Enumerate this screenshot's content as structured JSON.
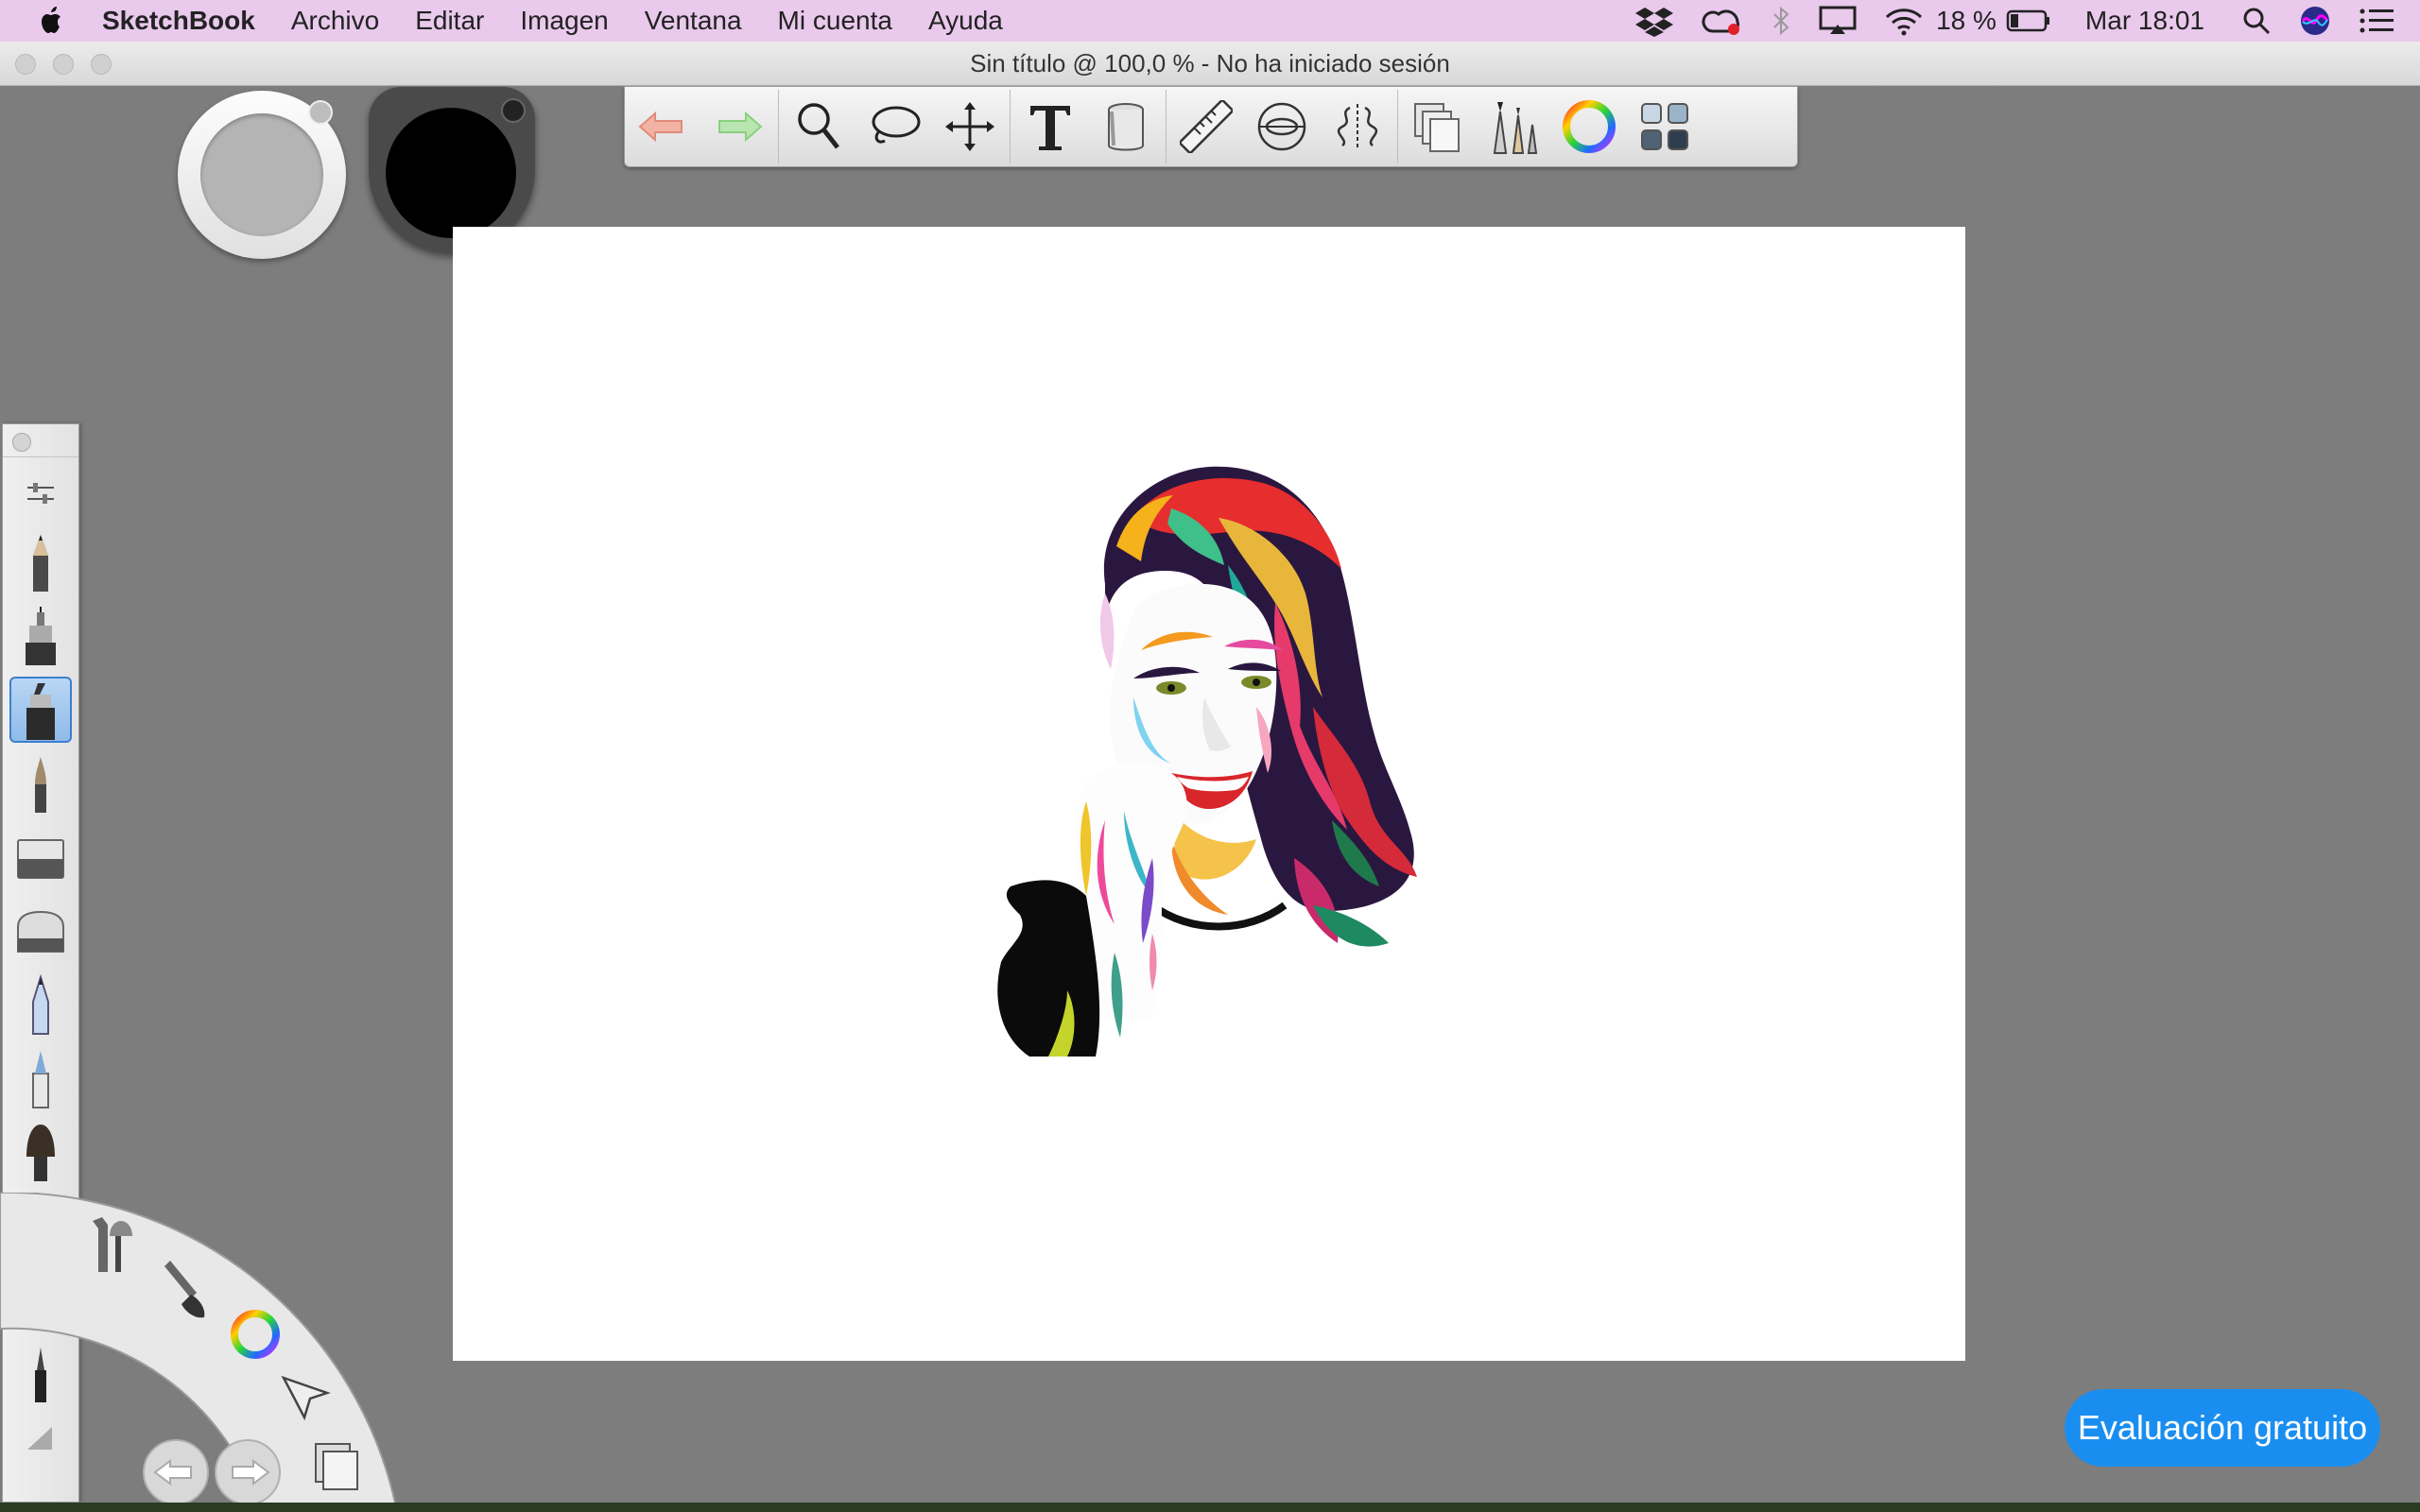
{
  "menubar": {
    "app_name": "SketchBook",
    "menus": [
      "Archivo",
      "Editar",
      "Imagen",
      "Ventana",
      "Mi cuenta",
      "Ayuda"
    ],
    "battery": "18 %",
    "clock": "Mar 18:01",
    "status_icons": [
      "dropbox-icon",
      "creative-cloud-icon",
      "bluetooth-icon",
      "airplay-icon",
      "wifi-icon",
      "battery-icon",
      "spotlight-icon",
      "siri-icon",
      "notification-center-icon"
    ]
  },
  "window": {
    "title": "Sin título @ 100,0 % - No ha iniciado sesión"
  },
  "colors": {
    "menubar_bg": "#e9c9ec",
    "workspace_bg": "#7d7d7d",
    "canvas_bg": "#ffffff",
    "primary_color": "#000000",
    "secondary_color": "#b4b4b4",
    "trial_button": "#1a8ef0"
  },
  "toolbar": {
    "tools": [
      "undo-icon",
      "redo-icon",
      "zoom-icon",
      "lasso-icon",
      "move-icon",
      "text-icon",
      "fill-bucket-icon",
      "ruler-icon",
      "ellipse-guide-icon",
      "symmetry-icon",
      "layers-icon",
      "brushes-icon",
      "color-wheel-icon",
      "copic-library-icon"
    ]
  },
  "brushes": [
    "pencil",
    "technical-pen",
    "marker",
    "paintbrush",
    "soft-eraser",
    "hard-eraser",
    "ballpoint-pen",
    "felt-pen",
    "flat-brush",
    "airbrush-hand",
    "chisel-marker",
    "fine-pen",
    "smudge"
  ],
  "lagoon": {
    "items": [
      "tools-icon",
      "brush-icon",
      "color-wheel-icon",
      "select-arrow-icon",
      "copy-icon",
      "undo-icon",
      "redo-icon"
    ]
  },
  "trial_button": {
    "label": "Evaluación gratuito"
  }
}
